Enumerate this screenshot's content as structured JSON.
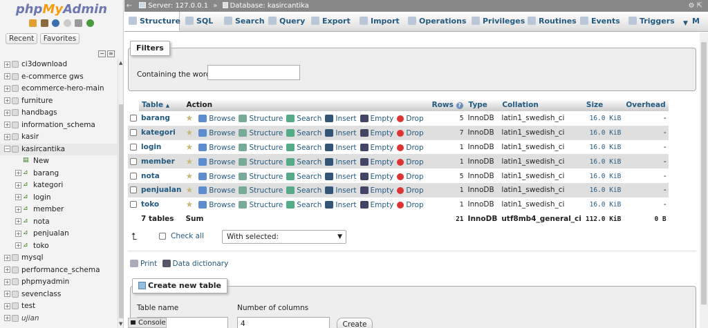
{
  "logo": {
    "php": "php",
    "my": "My",
    "admin": "Admin"
  },
  "sidebar": {
    "recent": "Recent",
    "favorites": "Favorites",
    "databases": [
      {
        "label": "ci3download",
        "level": 0
      },
      {
        "label": "e-commerce gws",
        "level": 0
      },
      {
        "label": "ecommerce-hero-main",
        "level": 0
      },
      {
        "label": "furniture",
        "level": 0
      },
      {
        "label": "handbags",
        "level": 0
      },
      {
        "label": "information_schema",
        "level": 0
      },
      {
        "label": "kasir",
        "level": 0
      },
      {
        "label": "kasircantika",
        "level": 0,
        "expanded": true
      },
      {
        "label": "New",
        "level": 1,
        "new": true
      },
      {
        "label": "barang",
        "level": 1
      },
      {
        "label": "kategori",
        "level": 1
      },
      {
        "label": "login",
        "level": 1
      },
      {
        "label": "member",
        "level": 1
      },
      {
        "label": "nota",
        "level": 1
      },
      {
        "label": "penjualan",
        "level": 1
      },
      {
        "label": "toko",
        "level": 1
      },
      {
        "label": "mysql",
        "level": 0
      },
      {
        "label": "performance_schema",
        "level": 0
      },
      {
        "label": "phpmyadmin",
        "level": 0
      },
      {
        "label": "sevenclass",
        "level": 0
      },
      {
        "label": "test",
        "level": 0
      },
      {
        "label": "ujian",
        "level": 0,
        "italic": true
      }
    ]
  },
  "topbar": {
    "server": "Server: 127.0.0.1",
    "separator": "»",
    "database": "Database: kasircantika"
  },
  "tabs": [
    {
      "label": "Structure",
      "icon": "structure-icon"
    },
    {
      "label": "SQL",
      "icon": "sql-icon"
    },
    {
      "label": "Search",
      "icon": "search-icon"
    },
    {
      "label": "Query",
      "icon": "query-icon"
    },
    {
      "label": "Export",
      "icon": "export-icon"
    },
    {
      "label": "Import",
      "icon": "import-icon"
    },
    {
      "label": "Operations",
      "icon": "wrench-icon"
    },
    {
      "label": "Privileges",
      "icon": "privileges-icon"
    },
    {
      "label": "Routines",
      "icon": "routines-icon"
    },
    {
      "label": "Events",
      "icon": "clock-icon"
    },
    {
      "label": "Triggers",
      "icon": "triggers-icon"
    },
    {
      "label": "M",
      "icon": "chevron-down-icon"
    }
  ],
  "filters": {
    "legend": "Filters",
    "label": "Containing the word:",
    "value": ""
  },
  "table": {
    "headers": {
      "table": "Table",
      "action": "Action",
      "rows": "Rows",
      "type": "Type",
      "collation": "Collation",
      "size": "Size",
      "overhead": "Overhead"
    },
    "actions": {
      "browse": "Browse",
      "structure": "Structure",
      "search": "Search",
      "insert": "Insert",
      "empty": "Empty",
      "drop": "Drop"
    },
    "rows": [
      {
        "name": "barang",
        "rows": "5",
        "type": "InnoDB",
        "collation": "latin1_swedish_ci",
        "size": "16.0 KiB",
        "overhead": "-"
      },
      {
        "name": "kategori",
        "rows": "7",
        "type": "InnoDB",
        "collation": "latin1_swedish_ci",
        "size": "16.0 KiB",
        "overhead": "-"
      },
      {
        "name": "login",
        "rows": "1",
        "type": "InnoDB",
        "collation": "latin1_swedish_ci",
        "size": "16.0 KiB",
        "overhead": "-"
      },
      {
        "name": "member",
        "rows": "1",
        "type": "InnoDB",
        "collation": "latin1_swedish_ci",
        "size": "16.0 KiB",
        "overhead": "-"
      },
      {
        "name": "nota",
        "rows": "5",
        "type": "InnoDB",
        "collation": "latin1_swedish_ci",
        "size": "16.0 KiB",
        "overhead": "-"
      },
      {
        "name": "penjualan",
        "rows": "1",
        "type": "InnoDB",
        "collation": "latin1_swedish_ci",
        "size": "16.0 KiB",
        "overhead": "-"
      },
      {
        "name": "toko",
        "rows": "1",
        "type": "InnoDB",
        "collation": "latin1_swedish_ci",
        "size": "16.0 KiB",
        "overhead": "-"
      }
    ],
    "summary": {
      "tables": "7 tables",
      "sum": "Sum",
      "rows": "21",
      "type": "InnoDB",
      "collation": "utf8mb4_general_ci",
      "size": "112.0 KiB",
      "overhead": "0 B"
    }
  },
  "bulk": {
    "check_all": "Check all",
    "with_selected": "With selected:"
  },
  "links": {
    "print": "Print",
    "data_dictionary": "Data dictionary"
  },
  "create": {
    "legend": "Create new table",
    "table_name_label": "Table name",
    "columns_label": "Number of columns",
    "columns_value": "4",
    "button": "Create"
  },
  "console": {
    "label": "Console"
  }
}
